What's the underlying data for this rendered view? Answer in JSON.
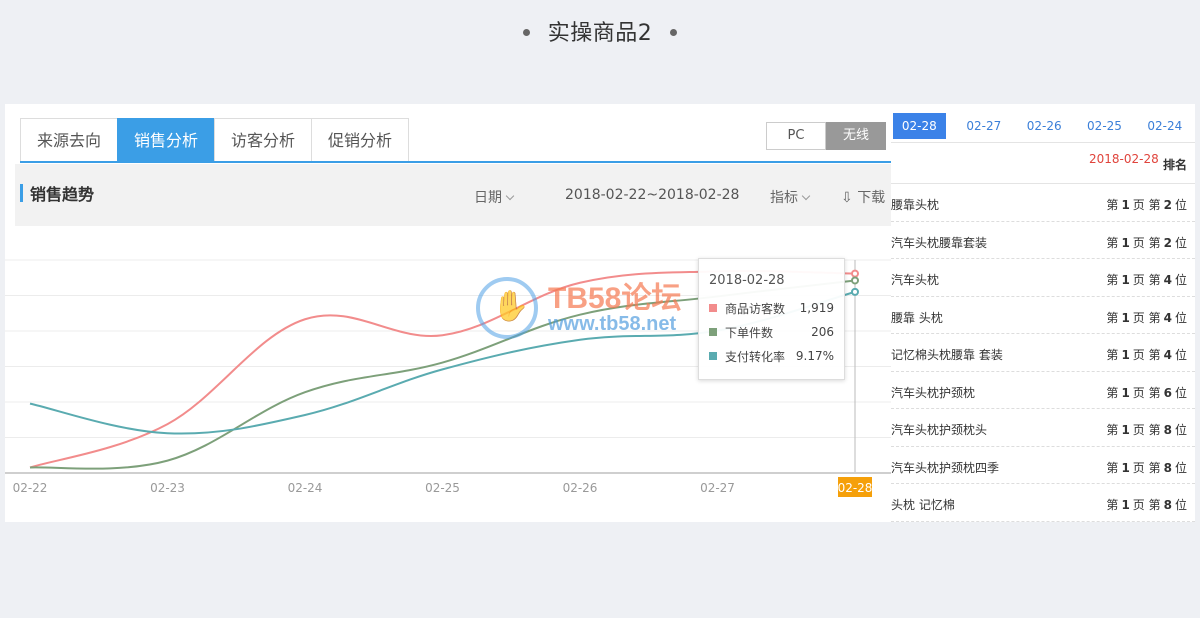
{
  "page": {
    "title": "实操商品2"
  },
  "tabs": [
    {
      "label": "来源去向",
      "active": false
    },
    {
      "label": "销售分析",
      "active": true
    },
    {
      "label": "访客分析",
      "active": false
    },
    {
      "label": "促销分析",
      "active": false
    }
  ],
  "device": {
    "pc": "PC",
    "wireless": "无线",
    "active": "无线"
  },
  "trend": {
    "title": "销售趋势",
    "date_label": "日期",
    "range": "2018-02-22~2018-02-28",
    "metric_label": "指标",
    "download_label": "下载"
  },
  "chart_data": {
    "type": "line",
    "categories": [
      "02-22",
      "02-23",
      "02-24",
      "02-25",
      "02-26",
      "02-27",
      "02-28"
    ],
    "highlighted_category": "02-28",
    "y_axis_labels": "none",
    "grid": true,
    "series": [
      {
        "name": "商品访客数",
        "color": "#f28c8c",
        "values": [
          0.02,
          0.21,
          0.67,
          0.6,
          0.83,
          0.88,
          0.87
        ]
      },
      {
        "name": "下单件数",
        "color": "#7da07a",
        "values": [
          0.02,
          0.05,
          0.35,
          0.48,
          0.69,
          0.77,
          0.84
        ]
      },
      {
        "name": "支付转化率",
        "color": "#5aabb0",
        "values": [
          0.3,
          0.17,
          0.25,
          0.45,
          0.58,
          0.62,
          0.79
        ]
      }
    ]
  },
  "tooltip": {
    "date": "2018-02-28",
    "rows": [
      {
        "name": "商品访客数",
        "value": "1,919",
        "color": "#f28c8c"
      },
      {
        "name": "下单件数",
        "value": "206",
        "color": "#7da07a"
      },
      {
        "name": "支付转化率",
        "value": "9.17%",
        "color": "#5aabb0"
      }
    ]
  },
  "watermark": {
    "title": "TB58论坛",
    "url": "www.tb58.net"
  },
  "rank_panel": {
    "dates": [
      {
        "label": "02-28",
        "active": true
      },
      {
        "label": "02-27",
        "active": false
      },
      {
        "label": "02-26",
        "active": false
      },
      {
        "label": "02-25",
        "active": false
      },
      {
        "label": "02-24",
        "active": false
      }
    ],
    "header_date": "2018-02-28",
    "header_rank": "排名",
    "rows": [
      {
        "keyword": "腰靠头枕",
        "page": "1",
        "pos": "2"
      },
      {
        "keyword": "汽车头枕腰靠套装",
        "page": "1",
        "pos": "2"
      },
      {
        "keyword": "汽车头枕",
        "page": "1",
        "pos": "4"
      },
      {
        "keyword": "腰靠 头枕",
        "page": "1",
        "pos": "4"
      },
      {
        "keyword": "记忆棉头枕腰靠 套装",
        "page": "1",
        "pos": "4"
      },
      {
        "keyword": "汽车头枕护颈枕",
        "page": "1",
        "pos": "6"
      },
      {
        "keyword": "汽车头枕护颈枕头",
        "page": "1",
        "pos": "8"
      },
      {
        "keyword": "汽车头枕护颈枕四季",
        "page": "1",
        "pos": "8"
      },
      {
        "keyword": "头枕 记忆棉",
        "page": "1",
        "pos": "8"
      }
    ],
    "rank_di": "第",
    "rank_ye": "页",
    "rank_wei": "位"
  }
}
